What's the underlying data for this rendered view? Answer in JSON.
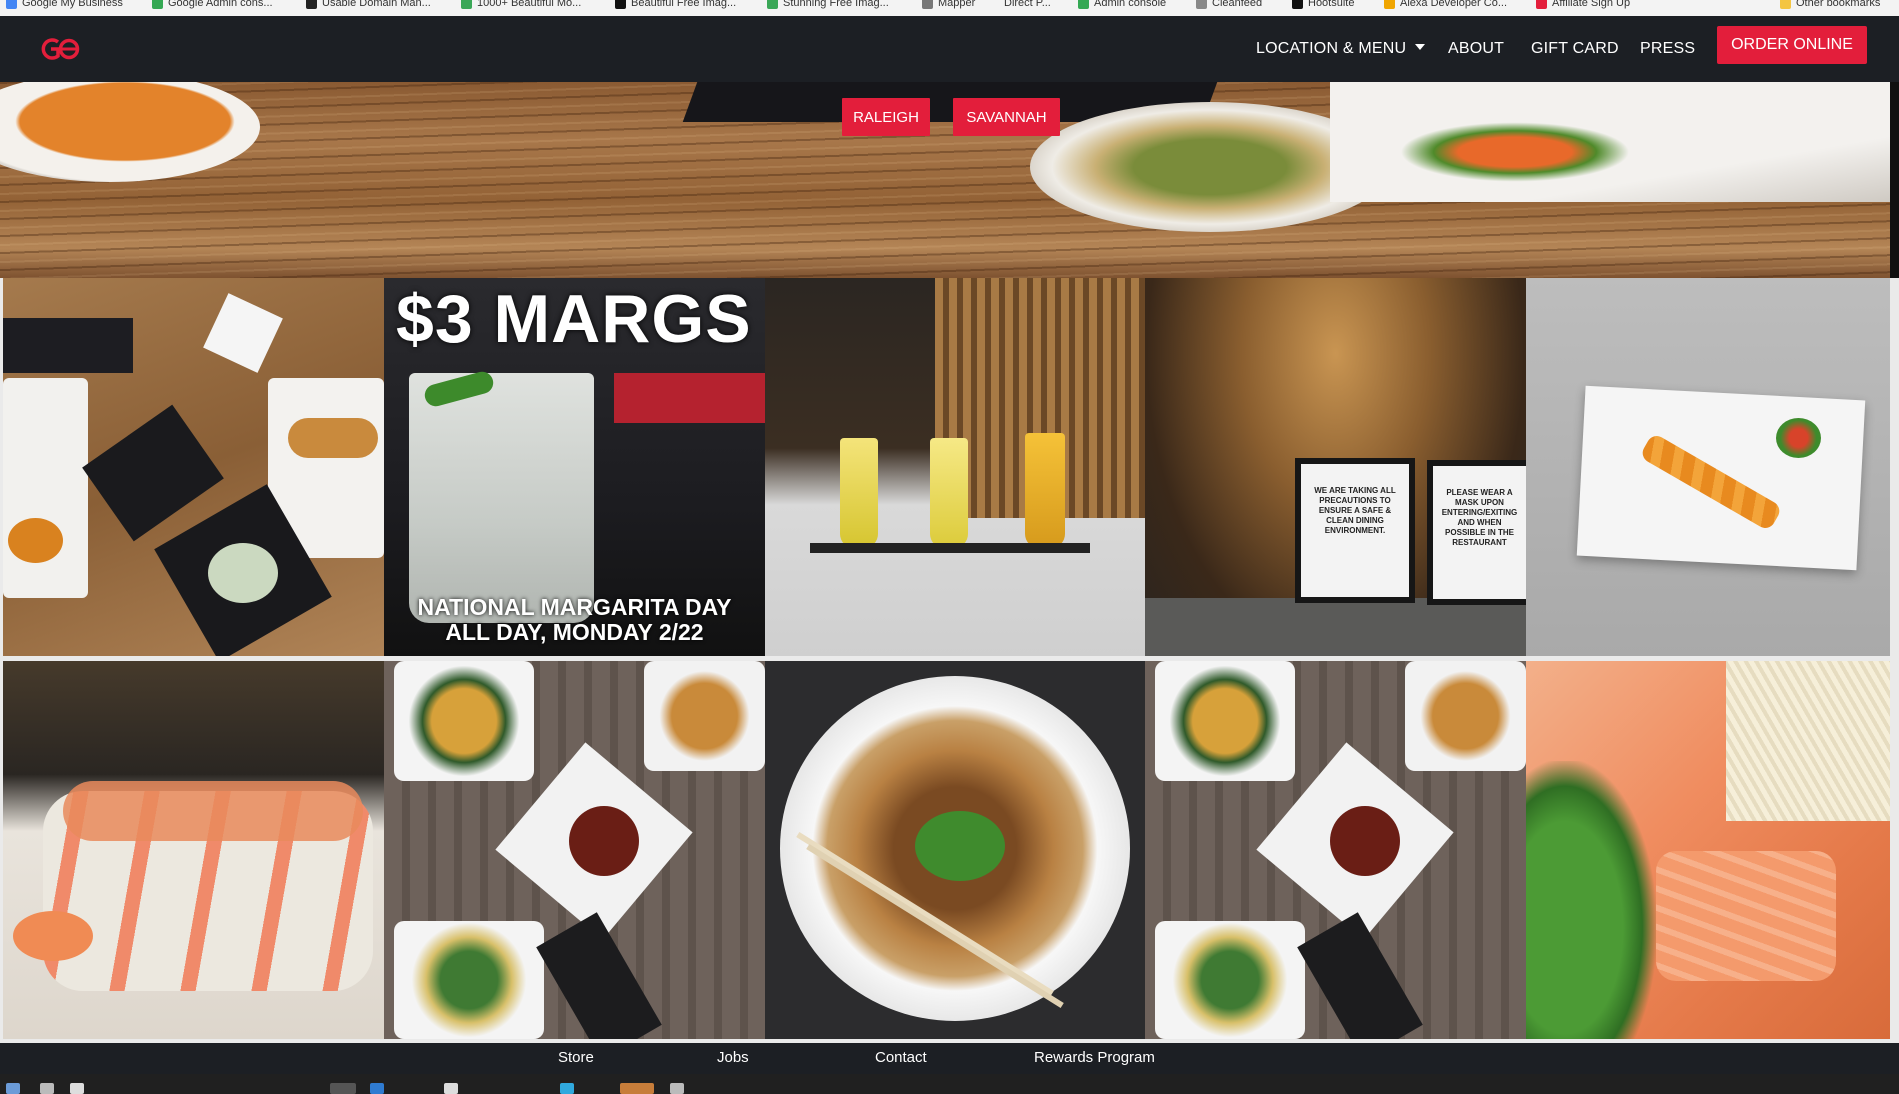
{
  "browser": {
    "bookmarks": [
      {
        "label": "Google My Business",
        "color": "#4285f4"
      },
      {
        "label": "Google Admin cons...",
        "color": "#34a853"
      },
      {
        "label": "Usable Domain Man...",
        "color": "#222222"
      },
      {
        "label": "1000+ Beautiful Mo...",
        "color": "#3aa757"
      },
      {
        "label": "Beautiful Free Imag...",
        "color": "#111111"
      },
      {
        "label": "Stunning Free Imag...",
        "color": "#3aa757"
      },
      {
        "label": "Mapper",
        "color": "#777777"
      },
      {
        "label": "Direct P...",
        "color": "#999999"
      },
      {
        "label": "Admin console",
        "color": "#34a853"
      },
      {
        "label": "Cleanfeed",
        "color": "#888888"
      },
      {
        "label": "Hootsuite",
        "color": "#111111"
      },
      {
        "label": "Alexa Developer Co...",
        "color": "#f0a500"
      },
      {
        "label": "Affiliate Sign Up",
        "color": "#e31e3b"
      }
    ],
    "other_bookmarks": "Other bookmarks"
  },
  "header": {
    "logo_text": "GO",
    "nav": [
      {
        "label": "LOCATION & MENU",
        "dropdown": true
      },
      {
        "label": "ABOUT"
      },
      {
        "label": "GIFT CARD"
      },
      {
        "label": "PRESS"
      }
    ],
    "order_button": "ORDER ONLINE"
  },
  "hero": {
    "locations": [
      "RALEIGH",
      "SAVANNAH"
    ]
  },
  "gallery": {
    "tiles": [
      {
        "name": "spring-rolls-banh-mi",
        "alt": "Table spread with spring rolls, banh mi and cocktail"
      },
      {
        "name": "margs-promo",
        "headline": "$3 MARGS",
        "caption_line1": "NATIONAL MARGARITA DAY",
        "caption_line2": "ALL DAY, MONDAY 2/22"
      },
      {
        "name": "bar-drinks",
        "alt": "Three yellow drinks on the bar"
      },
      {
        "name": "safety-signs",
        "sign1": "WE ARE TAKING ALL PRECAUTIONS TO ENSURE A SAFE & CLEAN DINING ENVIRONMENT.",
        "sign2": "PLEASE WEAR A MASK UPON ENTERING/EXITING AND WHEN POSSIBLE IN THE RESTAURANT"
      },
      {
        "name": "plated-appetizer",
        "alt": "Plated appetizer on white dish"
      },
      {
        "name": "sushi-rolls",
        "alt": "Sushi rolls"
      },
      {
        "name": "table-spread-a",
        "alt": "Ramen, wings and noodle dishes"
      },
      {
        "name": "noodle-bowl",
        "alt": "Stir-fried noodles with chopsticks"
      },
      {
        "name": "table-spread-b",
        "alt": "Ramen, wings and noodle dishes"
      },
      {
        "name": "salmon-noodles",
        "alt": "Salmon with noodles and herbs"
      }
    ]
  },
  "footer": {
    "links": [
      "Store",
      "Jobs",
      "Contact",
      "Rewards Program"
    ]
  },
  "colors": {
    "brand_red": "#e31e3b",
    "header_bg": "#1c1f24"
  }
}
